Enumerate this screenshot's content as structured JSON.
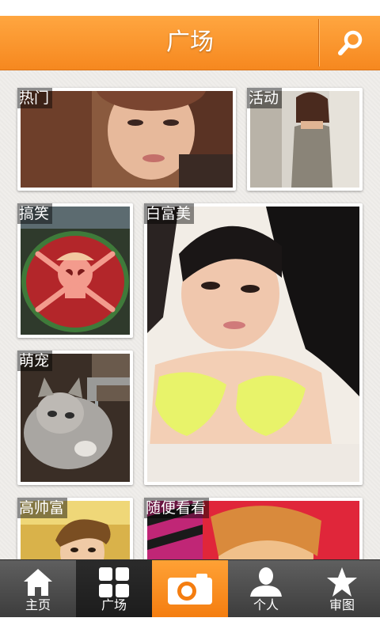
{
  "header": {
    "title": "广场",
    "search_icon": "search-icon"
  },
  "tiles": [
    {
      "label": "热门"
    },
    {
      "label": "活动"
    },
    {
      "label": "搞笑"
    },
    {
      "label": "白富美"
    },
    {
      "label": "萌宠"
    },
    {
      "label": "高帅富"
    },
    {
      "label": "随便看看"
    }
  ],
  "tabbar": {
    "home": "主页",
    "square": "广场",
    "camera_icon": "camera-icon",
    "profile": "个人",
    "featured": "审图"
  },
  "colors": {
    "accent": "#f6881f",
    "tabbar": "#4a4a4a"
  }
}
